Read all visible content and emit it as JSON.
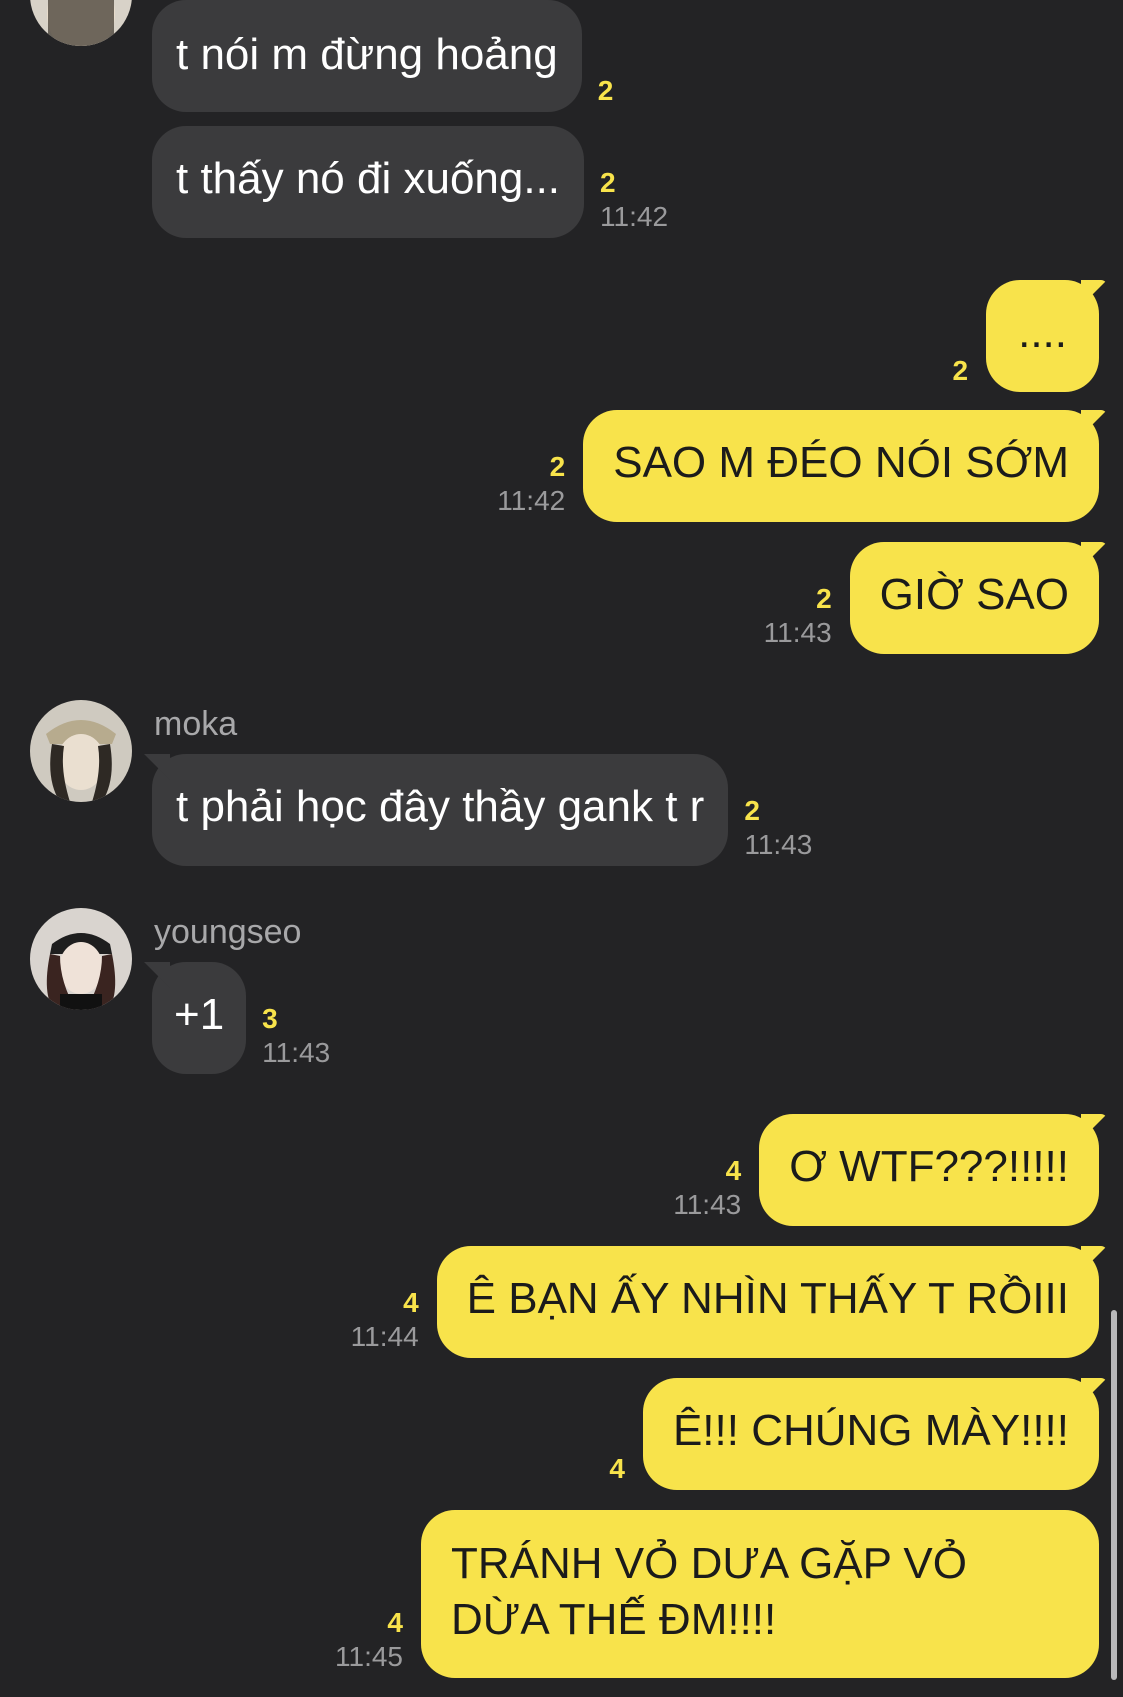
{
  "chat": {
    "messages": [
      {
        "text": "t nói m đừng hoảng",
        "unread": "2",
        "time": ""
      },
      {
        "text": "t thấy nó đi xuống...",
        "unread": "2",
        "time": "11:42"
      },
      {
        "text": "....",
        "unread": "2",
        "time": ""
      },
      {
        "text": "SAO M ĐÉO NÓI SỚM",
        "unread": "2",
        "time": "11:42"
      },
      {
        "text": "GIỜ SAO",
        "unread": "2",
        "time": "11:43"
      },
      {
        "sender": "moka",
        "text": "t phải học đây thầy gank t r",
        "unread": "2",
        "time": "11:43"
      },
      {
        "sender": "youngseo",
        "text": "+1",
        "unread": "3",
        "time": "11:43"
      },
      {
        "text": "Ơ WTF???!!!!!",
        "unread": "4",
        "time": "11:43"
      },
      {
        "text": "Ê BẠN ẤY NHÌN THẤY T RỒIII",
        "unread": "4",
        "time": "11:44"
      },
      {
        "text": "Ê!!! CHÚNG MÀY!!!!",
        "unread": "4",
        "time": ""
      },
      {
        "text": "TRÁNH VỎ DƯA GẶP VỎ DỪA THẾ ĐM!!!!",
        "unread": "4",
        "time": "11:45"
      }
    ]
  },
  "colors": {
    "background": "#232325",
    "incoming_bubble": "#3b3b3d",
    "outgoing_bubble": "#f8e34b",
    "unread_count": "#f8e34b",
    "timestamp": "#9a9a9c"
  },
  "icons": {
    "avatar_moka": "profile-photo",
    "avatar_youngseo": "profile-photo"
  }
}
